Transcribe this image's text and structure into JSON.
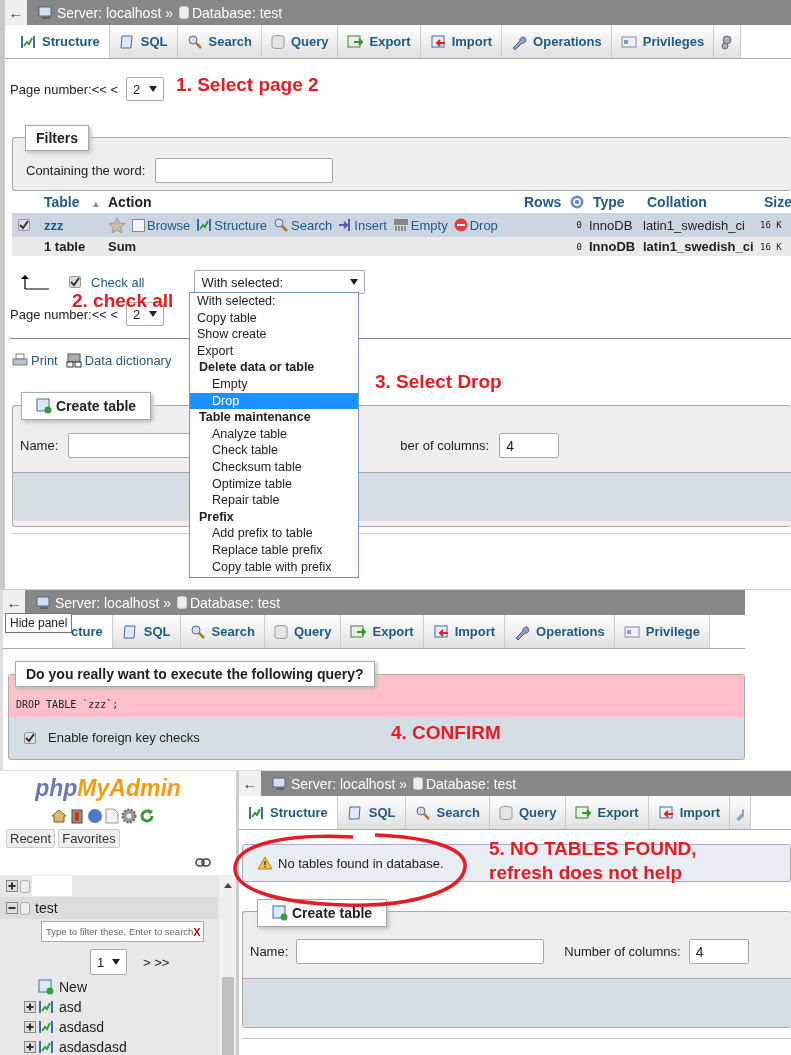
{
  "panel_1": {
    "back": "←",
    "server": "Server: localhost »",
    "database": "Database: test",
    "tabs": [
      {
        "label": "Structure",
        "selected": true
      },
      {
        "label": "SQL",
        "selected": false
      },
      {
        "label": "Search",
        "selected": false
      },
      {
        "label": "Query",
        "selected": false
      },
      {
        "label": "Export",
        "selected": false
      },
      {
        "label": "Import",
        "selected": false
      },
      {
        "label": "Operations",
        "selected": false
      },
      {
        "label": "Privileges",
        "selected": false
      }
    ],
    "page_label": "Page number:<< <",
    "page_value": "2",
    "annotation_1": "1. Select page 2",
    "filters": {
      "legend": "Filters",
      "label": "Containing the word:"
    },
    "table": {
      "columns": [
        {
          "label": "Table",
          "sort": "▲"
        },
        {
          "label": "Action"
        },
        {
          "label": "Rows"
        },
        {
          "label": "Type"
        },
        {
          "label": "Collation"
        },
        {
          "label": "Size"
        }
      ],
      "rows": [
        {
          "checked": true,
          "name": "zzz",
          "actions": [
            "Browse",
            "Structure",
            "Search",
            "Insert",
            "Empty",
            "Drop"
          ],
          "rows": "0",
          "type": "InnoDB",
          "collation": "latin1_swedish_ci",
          "size": "16 K"
        }
      ],
      "sum": {
        "name": "1 table",
        "label": "Sum",
        "rows": "0",
        "type": "InnoDB",
        "collation": "latin1_swedish_ci",
        "size": "16 K"
      }
    },
    "check_all": {
      "label": "Check all",
      "checked": true
    },
    "with_selected": "With selected:",
    "annotation_2": "2. check all",
    "page_label_2": "Page number:<< <",
    "page_value_2": "2",
    "links": [
      "Print",
      "Data dictionary"
    ],
    "create": {
      "legend": "Create table",
      "name_label": "Name:",
      "columns_label": "ber of columns:",
      "columns_value": "4"
    },
    "menu": [
      {
        "label": "With selected:",
        "kind": "option",
        "selected": false
      },
      {
        "label": "Copy table",
        "kind": "option",
        "selected": false
      },
      {
        "label": "Show create",
        "kind": "option",
        "selected": false
      },
      {
        "label": "Export",
        "kind": "option",
        "selected": false
      },
      {
        "label": "Delete data or table",
        "kind": "group"
      },
      {
        "label": "Empty",
        "kind": "suboption",
        "selected": false
      },
      {
        "label": "Drop",
        "kind": "suboption",
        "selected": true
      },
      {
        "label": "Table maintenance",
        "kind": "group"
      },
      {
        "label": "Analyze table",
        "kind": "suboption",
        "selected": false
      },
      {
        "label": "Check table",
        "kind": "suboption",
        "selected": false
      },
      {
        "label": "Checksum table",
        "kind": "suboption",
        "selected": false
      },
      {
        "label": "Optimize table",
        "kind": "suboption",
        "selected": false
      },
      {
        "label": "Repair table",
        "kind": "suboption",
        "selected": false
      },
      {
        "label": "Prefix",
        "kind": "group"
      },
      {
        "label": "Add prefix to table",
        "kind": "suboption",
        "selected": false
      },
      {
        "label": "Replace table prefix",
        "kind": "suboption",
        "selected": false
      },
      {
        "label": "Copy table with prefix",
        "kind": "suboption",
        "selected": false
      }
    ],
    "annotation_3": "3. Select Drop"
  },
  "panel_2": {
    "back": "←",
    "server": "Server: localhost »",
    "database": "Database: test",
    "tooltip": "Hide panel",
    "tabs": [
      {
        "label": "cture",
        "selected": true
      },
      {
        "label": "SQL",
        "selected": false
      },
      {
        "label": "Search",
        "selected": false
      },
      {
        "label": "Query",
        "selected": false
      },
      {
        "label": "Export",
        "selected": false
      },
      {
        "label": "Import",
        "selected": false
      },
      {
        "label": "Operations",
        "selected": false
      },
      {
        "label": "Privilege",
        "selected": false
      }
    ],
    "question": "Do you really want to execute the following query?",
    "query": "DROP TABLE `zzz`;",
    "fk": {
      "label": "Enable foreign key checks",
      "checked": true
    },
    "annotation_4": "4. CONFIRM"
  },
  "panel_3": {
    "logo": {
      "part_1": "php",
      "part_2": "MyAdmin"
    },
    "nav_buttons": [
      "Recent",
      "Favorites"
    ],
    "tree": [
      {
        "expanded": false
      },
      {
        "name": "test",
        "expanded": true,
        "filter_placeholder": "Type to filter these, Enter to search",
        "filter_clear": "X",
        "page_value": "1",
        "page_next": "> >>",
        "children": [
          {
            "name": "New",
            "kind": "new"
          },
          {
            "name": "asd",
            "kind": "table",
            "expanded": false
          },
          {
            "name": "asdasd",
            "kind": "table",
            "expanded": false
          },
          {
            "name": "asdasdasd",
            "kind": "table",
            "expanded": false
          }
        ]
      }
    ],
    "back": "←",
    "server": "Server: localhost »",
    "database": "Database: test",
    "tabs": [
      {
        "label": "Structure",
        "selected": true
      },
      {
        "label": "SQL",
        "selected": false
      },
      {
        "label": "Search",
        "selected": false
      },
      {
        "label": "Query",
        "selected": false
      },
      {
        "label": "Export",
        "selected": false
      },
      {
        "label": "Import",
        "selected": false
      }
    ],
    "notice": "No tables found in database.",
    "annotation_5": [
      "5. NO TABLES FOUND,",
      "refresh does not help"
    ],
    "create": {
      "legend": "Create table",
      "name_label": "Name:",
      "columns_label": "Number of columns:",
      "columns_value": "4"
    }
  }
}
